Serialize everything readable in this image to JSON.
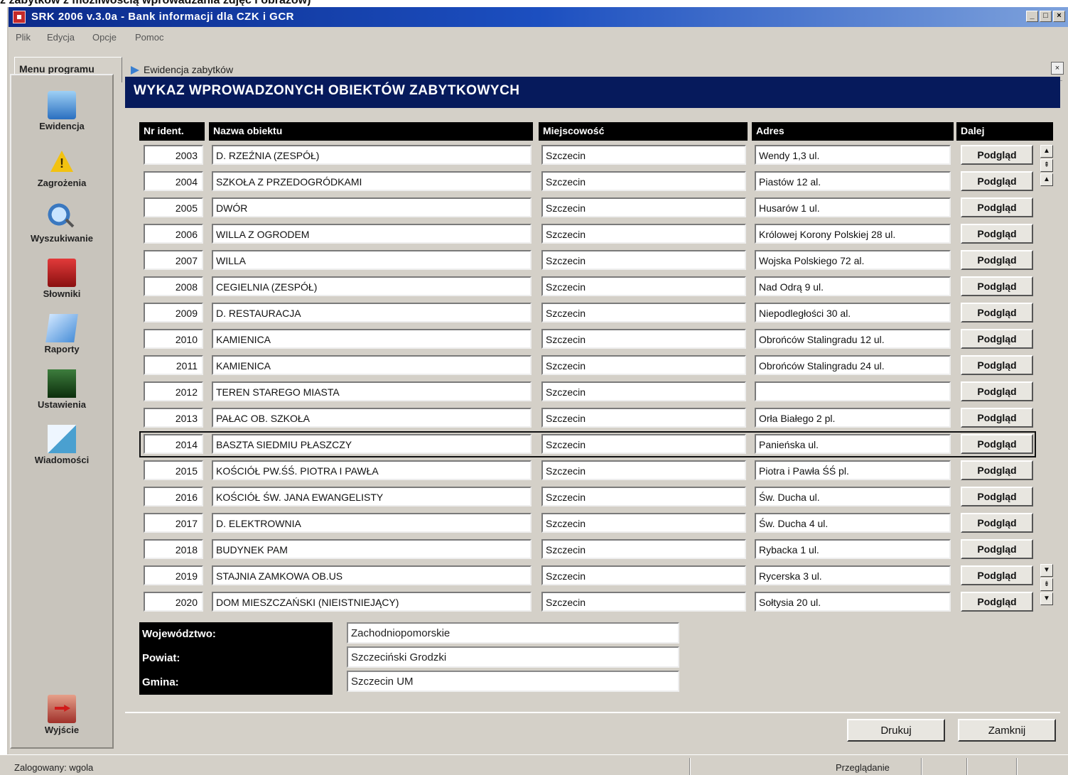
{
  "page_caption": "z zabytków z możliwością wprowadzania zdjęć i obrazów)",
  "window": {
    "title": "SRK 2006 v.3.0a - Bank informacji dla CZK i GCR",
    "buttons": [
      "_",
      "□",
      "×"
    ]
  },
  "menu": [
    "Plik",
    "Edycja",
    "Opcje",
    "Pomoc"
  ],
  "tabs": {
    "menu_tab": "Menu programu",
    "active_tab": "Ewidencja zabytków",
    "close": "×"
  },
  "sidebar": {
    "items": [
      {
        "label": "Ewidencja",
        "icon": "database-icon"
      },
      {
        "label": "Zagrożenia",
        "icon": "warning-icon"
      },
      {
        "label": "Wyszukiwanie",
        "icon": "search-icon"
      },
      {
        "label": "Słowniki",
        "icon": "book-icon"
      },
      {
        "label": "Raporty",
        "icon": "report-icon"
      },
      {
        "label": "Ustawienia",
        "icon": "settings-icon"
      },
      {
        "label": "Wiadomości",
        "icon": "message-icon"
      }
    ],
    "exit": {
      "label": "Wyjście",
      "icon": "exit-icon"
    }
  },
  "header_title": "WYKAZ WPROWADZONYCH OBIEKTÓW ZABYTKOWYCH",
  "table": {
    "columns": [
      "Nr ident.",
      "Nazwa obiektu",
      "Miejscowość",
      "Adres",
      "Dalej"
    ],
    "button_label": "Podgląd",
    "rows": [
      {
        "id": "2003",
        "name": "D. RZEŹNIA (ZESPÓŁ)",
        "city": "Szczecin",
        "address": "Wendy 1,3 ul."
      },
      {
        "id": "2004",
        "name": "SZKOŁA Z PRZEDOGRÓDKAMI",
        "city": "Szczecin",
        "address": "Piastów 12 al."
      },
      {
        "id": "2005",
        "name": "DWÓR",
        "city": "Szczecin",
        "address": "Husarów 1 ul."
      },
      {
        "id": "2006",
        "name": "WILLA Z OGRODEM",
        "city": "Szczecin",
        "address": "Królowej Korony Polskiej 28 ul."
      },
      {
        "id": "2007",
        "name": "WILLA",
        "city": "Szczecin",
        "address": "Wojska Polskiego 72 al."
      },
      {
        "id": "2008",
        "name": "CEGIELNIA (ZESPÓŁ)",
        "city": "Szczecin",
        "address": "Nad Odrą 9 ul."
      },
      {
        "id": "2009",
        "name": "D. RESTAURACJA",
        "city": "Szczecin",
        "address": "Niepodległości 30 al."
      },
      {
        "id": "2010",
        "name": "KAMIENICA",
        "city": "Szczecin",
        "address": "Obrońców Stalingradu 12 ul."
      },
      {
        "id": "2011",
        "name": "KAMIENICA",
        "city": "Szczecin",
        "address": "Obrońców Stalingradu 24 ul."
      },
      {
        "id": "2012",
        "name": "TEREN STAREGO MIASTA",
        "city": "Szczecin",
        "address": ""
      },
      {
        "id": "2013",
        "name": "PAŁAC OB. SZKOŁA",
        "city": "Szczecin",
        "address": "Orła Białego 2 pl."
      },
      {
        "id": "2014",
        "name": "BASZTA SIEDMIU PŁASZCZY",
        "city": "Szczecin",
        "address": "Panieńska ul."
      },
      {
        "id": "2015",
        "name": "KOŚCIÓŁ PW.ŚŚ. PIOTRA I PAWŁA",
        "city": "Szczecin",
        "address": "Piotra i Pawła ŚŚ pl."
      },
      {
        "id": "2016",
        "name": "KOŚCIÓŁ ŚW. JANA EWANGELISTY",
        "city": "Szczecin",
        "address": "Św. Ducha ul."
      },
      {
        "id": "2017",
        "name": "D. ELEKTROWNIA",
        "city": "Szczecin",
        "address": "Św. Ducha 4 ul."
      },
      {
        "id": "2018",
        "name": "BUDYNEK PAM",
        "city": "Szczecin",
        "address": "Rybacka 1 ul."
      },
      {
        "id": "2019",
        "name": "STAJNIA ZAMKOWA OB.US",
        "city": "Szczecin",
        "address": "Rycerska 3 ul."
      },
      {
        "id": "2020",
        "name": "DOM MIESZCZAŃSKI (NIEISTNIEJĄCY)",
        "city": "Szczecin",
        "address": "Sołtysia 20 ul."
      }
    ],
    "selected_row": "2014"
  },
  "scroll": {
    "top": [
      "▲",
      "⇞",
      "▲"
    ],
    "bottom": [
      "▼",
      "⇟",
      "▼"
    ]
  },
  "location": {
    "wojewodztwo_label": "Województwo:",
    "wojewodztwo_value": "Zachodniopomorskie",
    "powiat_label": "Powiat:",
    "powiat_value": "Szczeciński Grodzki",
    "gmina_label": "Gmina:",
    "gmina_value": "Szczecin UM"
  },
  "footer": {
    "print_label": "Drukuj",
    "close_label": "Zamknij"
  },
  "status": {
    "left": "Zalogowany: wgola",
    "right": "Przeglądanie"
  },
  "colors": {
    "header_bg": "#061a5c",
    "title_bar_start": "#0b2a8a",
    "column_header_bg": "#000000",
    "window_bg": "#d4d0c8"
  }
}
